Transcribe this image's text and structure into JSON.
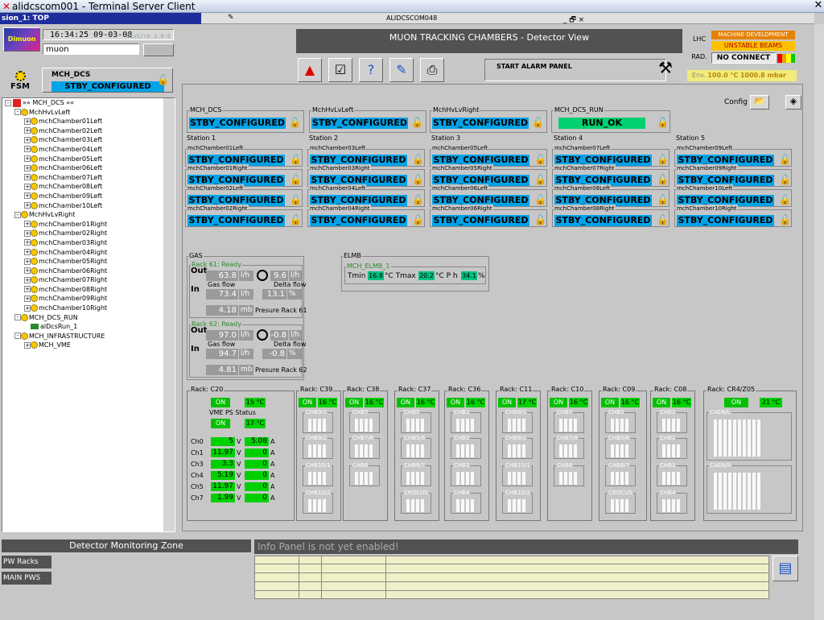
{
  "window": {
    "title": "alidcscom001 - Terminal Server Client",
    "subtitle": "sion_1: TOP",
    "host": "ALIDCSCOM048",
    "controls": "_ 🗗 ×"
  },
  "left": {
    "logo": "Dimuon",
    "clock": "16:34:25 09-03-08",
    "clock_extra": "dist/re 3.8.0",
    "user": "muon",
    "fsm_label": "FSM",
    "fsm_node": "MCH_DCS",
    "fsm_state": "STBY_CONFIGURED"
  },
  "tree": [
    {
      "t": "»» MCH_DCS ««",
      "lvl": 0,
      "root": true
    },
    {
      "t": "MchHvLvLeft",
      "lvl": 1,
      "ex": "-"
    },
    {
      "t": "mchChamber01Left",
      "lvl": 2,
      "ex": "+"
    },
    {
      "t": "mchChamber02Left",
      "lvl": 2,
      "ex": "+"
    },
    {
      "t": "mchChamber03Left",
      "lvl": 2,
      "ex": "+"
    },
    {
      "t": "mchChamber04Left",
      "lvl": 2,
      "ex": "+"
    },
    {
      "t": "mchChamber05Left",
      "lvl": 2,
      "ex": "+"
    },
    {
      "t": "mchChamber06Left",
      "lvl": 2,
      "ex": "+"
    },
    {
      "t": "mchChamber07Left",
      "lvl": 2,
      "ex": "+"
    },
    {
      "t": "mchChamber08Left",
      "lvl": 2,
      "ex": "+"
    },
    {
      "t": "mchChamber09Left",
      "lvl": 2,
      "ex": "+"
    },
    {
      "t": "mchChamber10Left",
      "lvl": 2,
      "ex": "+"
    },
    {
      "t": "MchHvLvRight",
      "lvl": 1,
      "ex": "-"
    },
    {
      "t": "mchChamber01Right",
      "lvl": 2,
      "ex": "+"
    },
    {
      "t": "mchChamber02Right",
      "lvl": 2,
      "ex": "+"
    },
    {
      "t": "mchChamber03Right",
      "lvl": 2,
      "ex": "+"
    },
    {
      "t": "mchChamber04Right",
      "lvl": 2,
      "ex": "+"
    },
    {
      "t": "mchChamber05Right",
      "lvl": 2,
      "ex": "+"
    },
    {
      "t": "mchChamber06Right",
      "lvl": 2,
      "ex": "+"
    },
    {
      "t": "mchChamber07Right",
      "lvl": 2,
      "ex": "+"
    },
    {
      "t": "mchChamber08Right",
      "lvl": 2,
      "ex": "+"
    },
    {
      "t": "mchChamber09Right",
      "lvl": 2,
      "ex": "+"
    },
    {
      "t": "mchChamber10Right",
      "lvl": 2,
      "ex": "+"
    },
    {
      "t": "MCH_DCS_RUN",
      "lvl": 1,
      "ex": "-"
    },
    {
      "t": "alDcsRun_1",
      "lvl": 2,
      "ex": "",
      "dev": true
    },
    {
      "t": "MCH_INFRASTRUCTURE",
      "lvl": 1,
      "ex": "-"
    },
    {
      "t": "MCH_VME",
      "lvl": 2,
      "ex": "+"
    }
  ],
  "header": {
    "title": "MUON TRACKING CHAMBERS - Detector View",
    "alarm": "START ALARM PANEL",
    "lhc": "LHC",
    "machine": "MACHINE DEVELOPMENT",
    "beams": "UNSTABLE BEAMS",
    "rad": "RAD.",
    "noconnect": "NO CONNECT",
    "env_label": "Env.",
    "env_temp": "100.0 °C",
    "env_press": "1000.8 mbar",
    "config": "Config",
    "colors": {
      "accent": "#00a3e8",
      "ok": "#00d070",
      "warn": "#ffc000"
    }
  },
  "top_groups": [
    {
      "label": "MCH_DCS",
      "state": "STBY_CONFIGURED"
    },
    {
      "label": "MchHvLvLeft",
      "state": "STBY_CONFIGURED"
    },
    {
      "label": "MchHvLvRight",
      "state": "STBY_CONFIGURED"
    },
    {
      "label": "MCH_DCS_RUN",
      "state": "RUN_OK"
    }
  ],
  "stations": [
    {
      "label": "Station 1",
      "ch": [
        "mchChamber01Left",
        "mchChamber01Right",
        "mchChamber02Left",
        "mchChamber02Right"
      ]
    },
    {
      "label": "Station 2",
      "ch": [
        "mchChamber03Left",
        "mchChamber03Right",
        "mchChamber04Left",
        "mchChamber04Right"
      ]
    },
    {
      "label": "Station 3",
      "ch": [
        "mchChamber05Left",
        "mchChamber05Right",
        "mchChamber06Left",
        "mchChamber06Right"
      ]
    },
    {
      "label": "Station 4",
      "ch": [
        "mchChamber07Left",
        "mchChamber07Right",
        "mchChamber08Left",
        "mchChamber08Right"
      ]
    },
    {
      "label": "Station 5",
      "ch": [
        "mchChamber09Left",
        "mchChamber09Right",
        "mchChamber10Left",
        "mchChamber10Right"
      ]
    }
  ],
  "station_state": "STBY_CONFIGURED",
  "gas": {
    "label": "GAS",
    "racks": [
      {
        "name": "Rack 61: Ready",
        "out": "63.8",
        "out_u": "l/h",
        "flow": "73.4",
        "flow_u": "l/h",
        "delta": "9.6",
        "delta_u": "l/h",
        "pct": "13.1",
        "pct_u": "%",
        "press": "4.18",
        "press_u": "mb",
        "press_lbl": "Presure Rack 61"
      },
      {
        "name": "Rack 62: Ready",
        "out": "97.0",
        "out_u": "l/h",
        "flow": "94.7",
        "flow_u": "l/h",
        "delta": "-0.8",
        "delta_u": "l/h",
        "pct": "-0.8",
        "pct_u": "%",
        "press": "4.81",
        "press_u": "mb",
        "press_lbl": "Presure Rack 62"
      }
    ],
    "out_lbl": "Out",
    "in_lbl": "In",
    "gasflow_lbl": "Gas flow",
    "deltaflow_lbl": "Delta flow"
  },
  "elmb": {
    "label": "ELMB",
    "name": "MCH_ELMB_1",
    "tmin_lbl": "Tmin",
    "tmin": "16.8",
    "tmax_lbl": "°C Tmax",
    "tmax": "20.2",
    "ph_lbl": "°C  P h",
    "ph": "34.1",
    "pct": "%"
  },
  "rackc20": {
    "label": "Rack: C20",
    "on": "ON",
    "temp": "15 °C",
    "vme": "VME PS Status",
    "vme_on": "ON",
    "vme_temp": "17 °C",
    "channels": [
      {
        "n": "Ch0",
        "v": "5",
        "a": "5.08"
      },
      {
        "n": "Ch1",
        "v": "11.97",
        "a": "0"
      },
      {
        "n": "Ch3",
        "v": "3.3",
        "a": "0"
      },
      {
        "n": "Ch4",
        "v": "5.19",
        "a": "0"
      },
      {
        "n": "Ch5",
        "v": "11.97",
        "a": "0"
      },
      {
        "n": "Ch7",
        "v": "1.99",
        "a": "0"
      }
    ],
    "vu": "V",
    "au": "A"
  },
  "racks": [
    {
      "label": "Rack: C39",
      "on": "ON",
      "temp": "16 °C",
      "chb": [
        "CHB9/1",
        "CHB9/2",
        "CHB10/1",
        "CHB10/2"
      ]
    },
    {
      "label": "Rack: C38",
      "on": "ON",
      "temp": "16 °C",
      "chb": [
        "CHB7",
        "CHB7/8",
        "CHB8"
      ]
    },
    {
      "label": "Rack: C37",
      "on": "ON",
      "temp": "16 °C",
      "chb": [
        "CHB5",
        "CHB5/6",
        "CHB6/7",
        "CROCUS"
      ]
    },
    {
      "label": "Rack: C36",
      "on": "ON",
      "temp": "16 °C",
      "chb": [
        "CHB1",
        "CHB2",
        "CHB3",
        "CHB4"
      ]
    },
    {
      "label": "Rack: C11",
      "on": "ON",
      "temp": "17 °C",
      "chb": [
        "CHB9/1",
        "CHB9/2",
        "CHB10/1",
        "CHB10/2"
      ]
    },
    {
      "label": "Rack: C10",
      "on": "ON",
      "temp": "16 °C",
      "chb": [
        "CHB7",
        "CHB7/8",
        "CHB8"
      ]
    },
    {
      "label": "Rack: C09",
      "on": "ON",
      "temp": "16 °C",
      "chb": [
        "CHB5",
        "CHB5/6",
        "CHB6/7",
        "CROCUS"
      ]
    },
    {
      "label": "Rack: C08",
      "on": "ON",
      "temp": "16 °C",
      "chb": [
        "CHB1",
        "CHB2",
        "CHB3",
        "CHB4"
      ]
    }
  ],
  "rackcr4": {
    "label": "Rack: CR4/Z05",
    "on": "ON",
    "temp": "21 °C",
    "caen1": "CAEN/L",
    "caen2": "CAEN/R"
  },
  "bottom": {
    "dmz": "Detector Monitoring Zone",
    "info": "Info Panel is not yet enabled!",
    "pw1": "PW Racks",
    "pw2": "MAIN PWS"
  }
}
